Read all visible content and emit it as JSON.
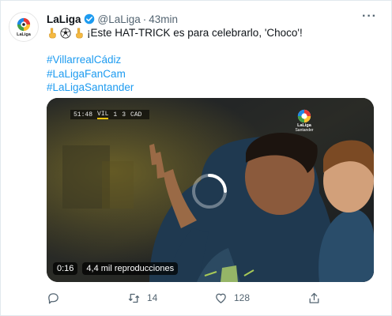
{
  "tweet": {
    "avatar_text": "LaLiga",
    "author_name": "LaLiga",
    "handle": "@LaLiga",
    "separator": "·",
    "time": "43min",
    "more_label": "···",
    "text": "¡Este HAT-TRICK es para celebrarlo, 'Choco'!",
    "emojis": [
      "pointing-down-hand-emoji",
      "soccer-ball-emoji",
      "pointing-down-hand-emoji"
    ],
    "hashtags": [
      "#VillarrealCádiz",
      "#LaLigaFanCam",
      "#LaLigaSantander"
    ]
  },
  "video": {
    "scorebug": {
      "clock": "51:48",
      "home": "VIL",
      "home_score": "1",
      "away_score": "3",
      "away": "CAD"
    },
    "brand_line1": "LaLiga",
    "brand_line2": "Santander",
    "duration": "0:16",
    "views": "4,4 mil reproducciones"
  },
  "actions": {
    "reply_count": "",
    "retweet_count": "14",
    "like_count": "128"
  },
  "colors": {
    "link": "#1d9bf0",
    "muted": "#536471",
    "verified": "#1d9bf0"
  }
}
